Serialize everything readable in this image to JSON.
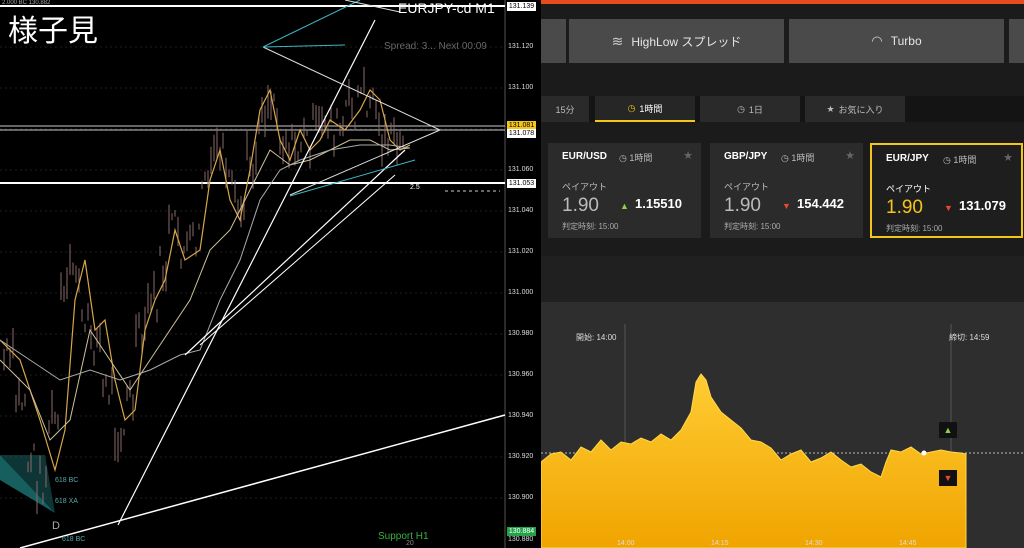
{
  "mt4": {
    "overlay_title": "様子見",
    "symbol": "EURJPY-cd M1",
    "spread_text": "Spread: 3... Next 00:09",
    "top_info": "2.000 BC  130.882",
    "support_label": "Support H1",
    "support_sub": "20",
    "fib_label": "2.5",
    "pattern_label": "D",
    "small_labels": [
      "618 BC",
      "618 XA",
      "618 BC"
    ],
    "price_scale": [
      "131.139",
      "131.120",
      "131.100",
      "131.080",
      "131.060",
      "131.040",
      "131.020",
      "131.000",
      "130.980",
      "130.960",
      "130.940",
      "130.920",
      "130.900",
      "130.880"
    ],
    "price_tags": {
      "top": "131.139",
      "yellow": "131.081",
      "white_mid": "131.078",
      "white_low": "131.053",
      "green": "130.884"
    }
  },
  "highlow": {
    "mode_tabs": [
      {
        "label": "HighLow スプレッド",
        "icon": "waves-icon"
      },
      {
        "label": "Turbo",
        "icon": "gauge-icon"
      }
    ],
    "time_tabs": [
      {
        "label": "15分",
        "icon": ""
      },
      {
        "label": "1時間",
        "icon": "clock-icon"
      },
      {
        "label": "1日",
        "icon": "clock-icon"
      },
      {
        "label": "お気に入り",
        "icon": "star-icon"
      }
    ],
    "cards": [
      {
        "pair": "EUR/USD",
        "period": "1時間",
        "payout_label": "ペイアウト",
        "payout": "1.90",
        "direction": "up",
        "rate": "1.15510",
        "expiry": "判定時刻: 15:00"
      },
      {
        "pair": "GBP/JPY",
        "period": "1時間",
        "payout_label": "ペイアウト",
        "payout": "1.90",
        "direction": "down",
        "rate": "154.442",
        "expiry": "判定時刻: 15:00"
      },
      {
        "pair": "EUR/JPY",
        "period": "1時間",
        "payout_label": "ペイアウト",
        "payout": "1.90",
        "direction": "down",
        "rate": "131.079",
        "expiry": "判定時刻: 15:00"
      }
    ],
    "chart": {
      "start_label": "開始: 14:00",
      "end_label": "締切: 14:59",
      "x_ticks": [
        "14:00",
        "14:15",
        "14:30",
        "14:45"
      ]
    },
    "colors": {
      "accent": "#f5c518",
      "up": "#8ad24a",
      "down": "#e8482c"
    }
  }
}
